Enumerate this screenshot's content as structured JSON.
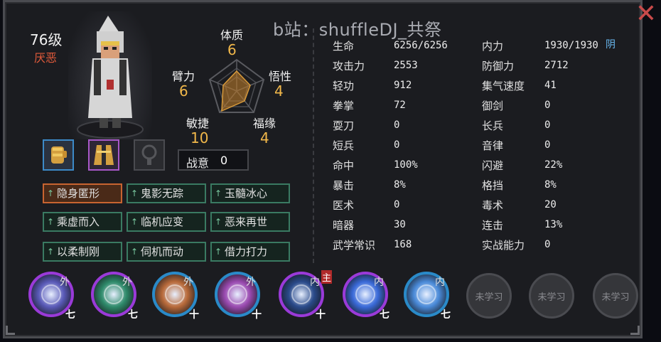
{
  "watermark": "b站：shuffleDJ_共祭",
  "character": {
    "level": "76级",
    "status": "厌恶"
  },
  "radar": {
    "tizhi": {
      "label": "体质",
      "value": "6"
    },
    "wuxing": {
      "label": "悟性",
      "value": "4"
    },
    "fuyuan": {
      "label": "福缘",
      "value": "4"
    },
    "minjie": {
      "label": "敏捷",
      "value": "10"
    },
    "bili": {
      "label": "臂力",
      "value": "6"
    }
  },
  "zhanyi": {
    "label": "战意",
    "value": "0"
  },
  "skills": [
    {
      "label": "隐身匿形",
      "active": true
    },
    {
      "label": "鬼影无踪",
      "active": false
    },
    {
      "label": "玉髓冰心",
      "active": false
    },
    {
      "label": "乘虚而入",
      "active": false
    },
    {
      "label": "临机应变",
      "active": false
    },
    {
      "label": "恶来再世",
      "active": false
    },
    {
      "label": "以柔制刚",
      "active": false
    },
    {
      "label": "伺机而动",
      "active": false
    },
    {
      "label": "借力打力",
      "active": false
    }
  ],
  "attrs_left": [
    {
      "label": "生命",
      "value": "6256/6256"
    },
    {
      "label": "攻击力",
      "value": "2553"
    },
    {
      "label": "轻功",
      "value": "912"
    },
    {
      "label": "拳掌",
      "value": "72"
    },
    {
      "label": "耍刀",
      "value": "0"
    },
    {
      "label": "短兵",
      "value": "0"
    },
    {
      "label": "命中",
      "value": "100%"
    },
    {
      "label": "暴击",
      "value": "8%"
    },
    {
      "label": "医术",
      "value": "0"
    },
    {
      "label": "暗器",
      "value": "30"
    },
    {
      "label": "武学常识",
      "value": "168"
    }
  ],
  "attrs_right": [
    {
      "label": "内力",
      "value": "1930/1930"
    },
    {
      "label": "防御力",
      "value": "2712"
    },
    {
      "label": "集气速度",
      "value": "41"
    },
    {
      "label": "御剑",
      "value": "0"
    },
    {
      "label": "长兵",
      "value": "0"
    },
    {
      "label": "音律",
      "value": "0"
    },
    {
      "label": "闪避",
      "value": "22%"
    },
    {
      "label": "格挡",
      "value": "8%"
    },
    {
      "label": "毒术",
      "value": "20"
    },
    {
      "label": "连击",
      "value": "13%"
    },
    {
      "label": "实战能力",
      "value": "0"
    }
  ],
  "neili_type": "阴",
  "martial_icons": [
    {
      "tag": "外",
      "rank": "七",
      "ring": "#9a3ad8",
      "core": "#5a5ab8"
    },
    {
      "tag": "外",
      "rank": "七",
      "ring": "#9a3ad8",
      "core": "#2e8a6a"
    },
    {
      "tag": "外",
      "rank": "十",
      "ring": "#2a8ac8",
      "core": "#b86a3a"
    },
    {
      "tag": "外",
      "rank": "十",
      "ring": "#2a8ac8",
      "core": "#9a4ab0"
    },
    {
      "tag": "内",
      "rank": "十",
      "ring": "#9a3ad8",
      "core": "#2a4a8a",
      "main": "主"
    },
    {
      "tag": "内",
      "rank": "七",
      "ring": "#9a3ad8",
      "core": "#3a6ad8"
    },
    {
      "tag": "内",
      "rank": "七",
      "ring": "#2a8ac8",
      "core": "#4a8ad8"
    }
  ],
  "locked_label": "未学习",
  "colors": {
    "accent_gold": "#f2b84a",
    "status_red": "#e05a3a",
    "yin_blue": "#69b8f0"
  }
}
